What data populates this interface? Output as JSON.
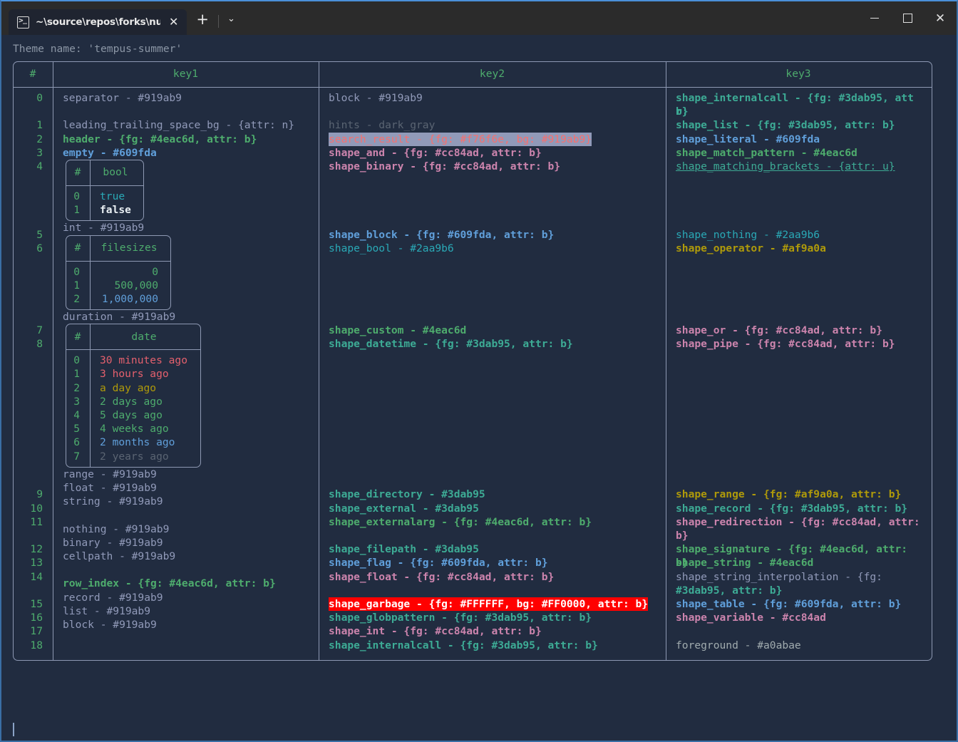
{
  "window": {
    "tab_title": "~\\source\\repos\\forks\\nu_scrip",
    "tab_icon": "powershell-icon",
    "close_tab_glyph": "✕",
    "new_tab_glyph": "+",
    "dropdown_glyph": "⌄",
    "minimize_label": "",
    "maximize_label": "",
    "close_label": "✕"
  },
  "terminal": {
    "theme_line": "Theme name: 'tempus-summer'",
    "prompt_cursor": "|"
  },
  "table": {
    "headers": {
      "index": "#",
      "key1": "key1",
      "key2": "key2",
      "key3": "key3"
    },
    "row_indices": [
      "0",
      "",
      "1",
      "2",
      "3",
      "4",
      "",
      "",
      "",
      "",
      "5",
      "6",
      "",
      "",
      "",
      "",
      "",
      "7",
      "8",
      "",
      "",
      "",
      "",
      "",
      "",
      "",
      "",
      "",
      "",
      "9",
      "10",
      "11",
      "",
      "12",
      "13",
      "14",
      "",
      "15",
      "16",
      "17",
      "18"
    ],
    "key1_lines": [
      "separator - #919ab9",
      "",
      "leading_trailing_space_bg - {attr: n}",
      "header - {fg: #4eac6d, attr: b}",
      "empty - #609fda"
    ],
    "key1_lines_b": [
      "int - #919ab9"
    ],
    "key1_lines_c": [
      "duration - #919ab9"
    ],
    "key1_lines_d": [
      "range - #919ab9",
      "float - #919ab9",
      "string - #919ab9",
      "",
      "nothing - #919ab9",
      "binary - #919ab9",
      "cellpath - #919ab9",
      "",
      "row_index - {fg: #4eac6d, attr: b}",
      "record - #919ab9",
      "list - #919ab9",
      "block - #919ab9"
    ],
    "key2_lines": [
      "block - #919ab9",
      "",
      "hints - dark_gray",
      "search_result - {fg: #f76f6e, bg: #919ab9}",
      "shape_and - {fg: #cc84ad, attr: b}",
      "shape_binary - {fg: #cc84ad, attr: b}",
      "",
      "",
      "",
      "",
      "shape_block - {fg: #609fda, attr: b}",
      "shape_bool - #2aa9b6",
      "",
      "",
      "",
      "",
      "",
      "shape_custom - #4eac6d",
      "shape_datetime - {fg: #3dab95, attr: b}",
      "",
      "",
      "",
      "",
      "",
      "",
      "",
      "",
      "",
      "",
      "shape_directory - #3dab95",
      "shape_external - #3dab95",
      "shape_externalarg - {fg: #4eac6d, attr: b}",
      "",
      "shape_filepath - #3dab95",
      "shape_flag - {fg: #609fda, attr: b}",
      "shape_float - {fg: #cc84ad, attr: b}",
      "",
      "shape_garbage - {fg: #FFFFFF, bg: #FF0000, attr: b}",
      "shape_globpattern - {fg: #3dab95, attr: b}",
      "shape_int - {fg: #cc84ad, attr: b}",
      "shape_internalcall - {fg: #3dab95, attr: b}"
    ],
    "key3_lines": [
      "shape_internalcall - {fg: #3dab95, attr:",
      "b}",
      "shape_list - {fg: #3dab95, attr: b}",
      "shape_literal - #609fda",
      "shape_match_pattern - #4eac6d",
      "shape_matching_brackets - {attr: u}",
      "",
      "",
      "",
      "",
      "shape_nothing - #2aa9b6",
      "shape_operator - #af9a0a",
      "",
      "",
      "",
      "",
      "",
      "shape_or - {fg: #cc84ad, attr: b}",
      "shape_pipe - {fg: #cc84ad, attr: b}",
      "",
      "",
      "",
      "",
      "",
      "",
      "",
      "",
      "",
      "",
      "shape_range - {fg: #af9a0a, attr: b}",
      "shape_record - {fg: #3dab95, attr: b}",
      "shape_redirection - {fg: #cc84ad, attr:",
      "b}",
      "shape_signature - {fg: #4eac6d, attr: b}",
      "shape_string - #4eac6d",
      "shape_string_interpolation - {fg:",
      "#3dab95, attr: b}",
      "shape_table - {fg: #609fda, attr: b}",
      "shape_variable - #cc84ad",
      "",
      "foreground - #a0abae"
    ]
  },
  "inner_tables": {
    "bool": {
      "header_index": "#",
      "header_value": "bool",
      "indices": [
        "0",
        "1"
      ],
      "values": [
        "true",
        "false"
      ]
    },
    "filesizes": {
      "header_index": "#",
      "header_value": "filesizes",
      "indices": [
        "0",
        "1",
        "2"
      ],
      "values": [
        "0",
        "500,000",
        "1,000,000"
      ]
    },
    "date": {
      "header_index": "#",
      "header_value": "date",
      "indices": [
        "0",
        "1",
        "2",
        "3",
        "4",
        "5",
        "6",
        "7"
      ],
      "values": [
        "30 minutes ago",
        "3 hours ago",
        "a day ago",
        "2 days ago",
        "5 days ago",
        "4 weeks ago",
        "2 months ago",
        "2 years ago"
      ]
    }
  },
  "colors": {
    "background": "#212c40",
    "titlebar": "#2b2b2b",
    "border_accent": "#3a6ea5",
    "table_border": "#8e99b3",
    "header_green": "#4eac6d",
    "gray_text": "#919ab9",
    "teal": "#3dab95",
    "blue": "#609fda",
    "pink": "#cc84ad",
    "cyan": "#2aa9b6",
    "yellow": "#af9a0a",
    "foreground": "#a0abae",
    "search_fg": "#f76f6e",
    "search_bg": "#919ab9",
    "garbage_fg": "#FFFFFF",
    "garbage_bg": "#FF0000"
  }
}
